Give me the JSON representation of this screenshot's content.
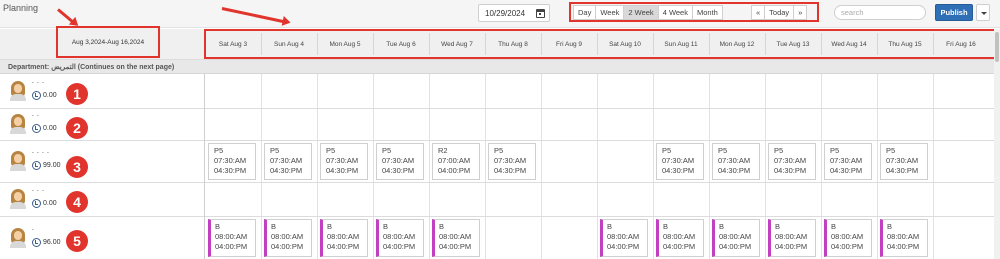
{
  "toolbar": {
    "title": "Planning",
    "date": "10/29/2024",
    "views": [
      "Day",
      "Week",
      "2 Week",
      "4 Week",
      "Month"
    ],
    "active_view": "2 Week",
    "prev": "«",
    "today": "Today",
    "next": "»",
    "search_placeholder": "search",
    "publish": "Publish"
  },
  "range": "Aug 3,2024-Aug 16,2024",
  "days": [
    "Sat Aug 3",
    "Sun Aug 4",
    "Mon Aug 5",
    "Tue Aug 6",
    "Wed Aug 7",
    "Thu Aug 8",
    "Fri Aug 9",
    "Sat Aug 10",
    "Sun Aug 11",
    "Mon Aug 12",
    "Tue Aug 13",
    "Wed Aug 14",
    "Thu Aug 15",
    "Fri Aug 16"
  ],
  "department": "Department: التمريض (Continues on the next page)",
  "employees": [
    {
      "number": "1",
      "name": "- - -",
      "hours": "0.00"
    },
    {
      "number": "2",
      "name": "- -",
      "hours": "0.00"
    },
    {
      "number": "3",
      "name": "- - - -",
      "hours": "99.00"
    },
    {
      "number": "4",
      "name": "- - -",
      "hours": "0.00"
    },
    {
      "number": "5",
      "name": "-",
      "hours": "96.00"
    }
  ],
  "shifts": [
    [],
    [],
    [
      {
        "day": 0,
        "code": "P5",
        "start": "07:30:AM",
        "end": "04:30:PM"
      },
      {
        "day": 1,
        "code": "P5",
        "start": "07:30:AM",
        "end": "04:30:PM"
      },
      {
        "day": 2,
        "code": "P5",
        "start": "07:30:AM",
        "end": "04:30:PM"
      },
      {
        "day": 3,
        "code": "P5",
        "start": "07:30:AM",
        "end": "04:30:PM"
      },
      {
        "day": 4,
        "code": "R2",
        "start": "07:00:AM",
        "end": "04:00:PM"
      },
      {
        "day": 5,
        "code": "P5",
        "start": "07:30:AM",
        "end": "04:30:PM"
      },
      {
        "day": 8,
        "code": "P5",
        "start": "07:30:AM",
        "end": "04:30:PM"
      },
      {
        "day": 9,
        "code": "P5",
        "start": "07:30:AM",
        "end": "04:30:PM"
      },
      {
        "day": 10,
        "code": "P5",
        "start": "07:30:AM",
        "end": "04:30:PM"
      },
      {
        "day": 11,
        "code": "P5",
        "start": "07:30:AM",
        "end": "04:30:PM"
      },
      {
        "day": 12,
        "code": "P5",
        "start": "07:30:AM",
        "end": "04:30:PM"
      }
    ],
    [],
    [
      {
        "day": 0,
        "code": "B",
        "start": "08:00:AM",
        "end": "04:00:PM"
      },
      {
        "day": 1,
        "code": "B",
        "start": "08:00:AM",
        "end": "04:00:PM"
      },
      {
        "day": 2,
        "code": "B",
        "start": "08:00:AM",
        "end": "04:00:PM"
      },
      {
        "day": 3,
        "code": "B",
        "start": "08:00:AM",
        "end": "04:00:PM"
      },
      {
        "day": 4,
        "code": "B",
        "start": "08:00:AM",
        "end": "04:00:PM"
      },
      {
        "day": 7,
        "code": "B",
        "start": "08:00:AM",
        "end": "04:00:PM"
      },
      {
        "day": 8,
        "code": "B",
        "start": "08:00:AM",
        "end": "04:00:PM"
      },
      {
        "day": 9,
        "code": "B",
        "start": "08:00:AM",
        "end": "04:00:PM"
      },
      {
        "day": 10,
        "code": "B",
        "start": "08:00:AM",
        "end": "04:00:PM"
      },
      {
        "day": 11,
        "code": "B",
        "start": "08:00:AM",
        "end": "04:00:PM"
      },
      {
        "day": 12,
        "code": "B",
        "start": "08:00:AM",
        "end": "04:00:PM"
      }
    ]
  ],
  "colors": {
    "annotation_red": "#e0342c",
    "publish_blue": "#2f6fb5",
    "shift_bar": "#c23fc2",
    "clock_blue": "#3b5d8d"
  }
}
